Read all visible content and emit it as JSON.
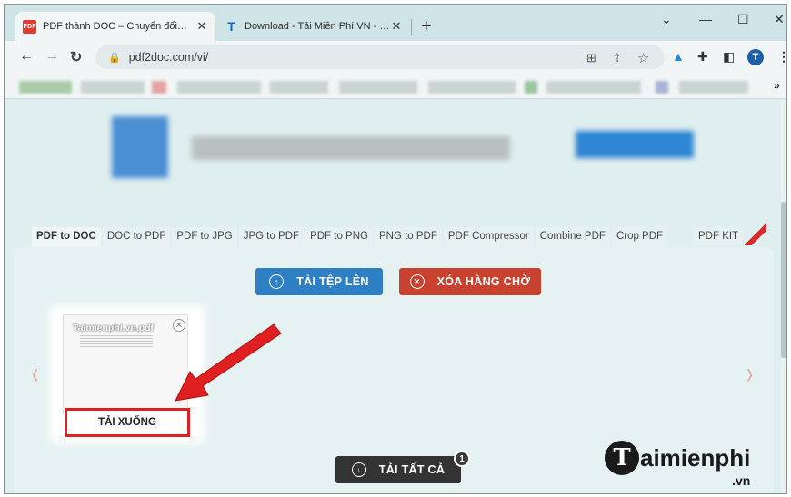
{
  "tabs": [
    {
      "title": "PDF thành DOC – Chuyển đổi trực tuyến",
      "favicon": "pdf-favicon-icon",
      "favicon_glyph": "PDF",
      "active": true
    },
    {
      "title": "Download - Tải Miễn Phí VN - Phần mềm",
      "favicon": "t-favicon-icon",
      "favicon_glyph": "T",
      "active": false
    }
  ],
  "window": {
    "new_tab": "+",
    "minimize": "—",
    "maximize": "☐",
    "close": "✕",
    "tab_search": "⌄"
  },
  "toolbar": {
    "back": "←",
    "forward": "→",
    "reload": "↻",
    "url": "pdf2doc.com/vi/",
    "lock": "🔒",
    "avatar_letter": "T",
    "menu": "⋮"
  },
  "bookmarks": {
    "more": "»"
  },
  "tool_tabs": [
    "PDF to DOC",
    "DOC to PDF",
    "PDF to JPG",
    "JPG to PDF",
    "PDF to PNG",
    "PNG to PDF",
    "PDF Compressor",
    "Combine PDF",
    "Crop PDF"
  ],
  "tool_tab_end": "PDF KIT",
  "buttons": {
    "upload": "TẢI TỆP LÊN",
    "clear": "XÓA HÀNG CHỜ",
    "download_all": "TẢI TẤT CẢ",
    "download_all_count": "1"
  },
  "file_card": {
    "name": "Taimienphi.vn.pdf",
    "close": "✕",
    "download": "TẢI XUỐNG"
  },
  "nav": {
    "prev": "‹",
    "next": "›"
  },
  "watermark": {
    "logo_letter": "T",
    "text": "aimienphi",
    "suffix": ".vn"
  },
  "colors": {
    "upload": "#2f7fc4",
    "clear": "#c9412f",
    "download_all": "#333333",
    "highlight": "#e02020",
    "arrow": "#e02020"
  }
}
